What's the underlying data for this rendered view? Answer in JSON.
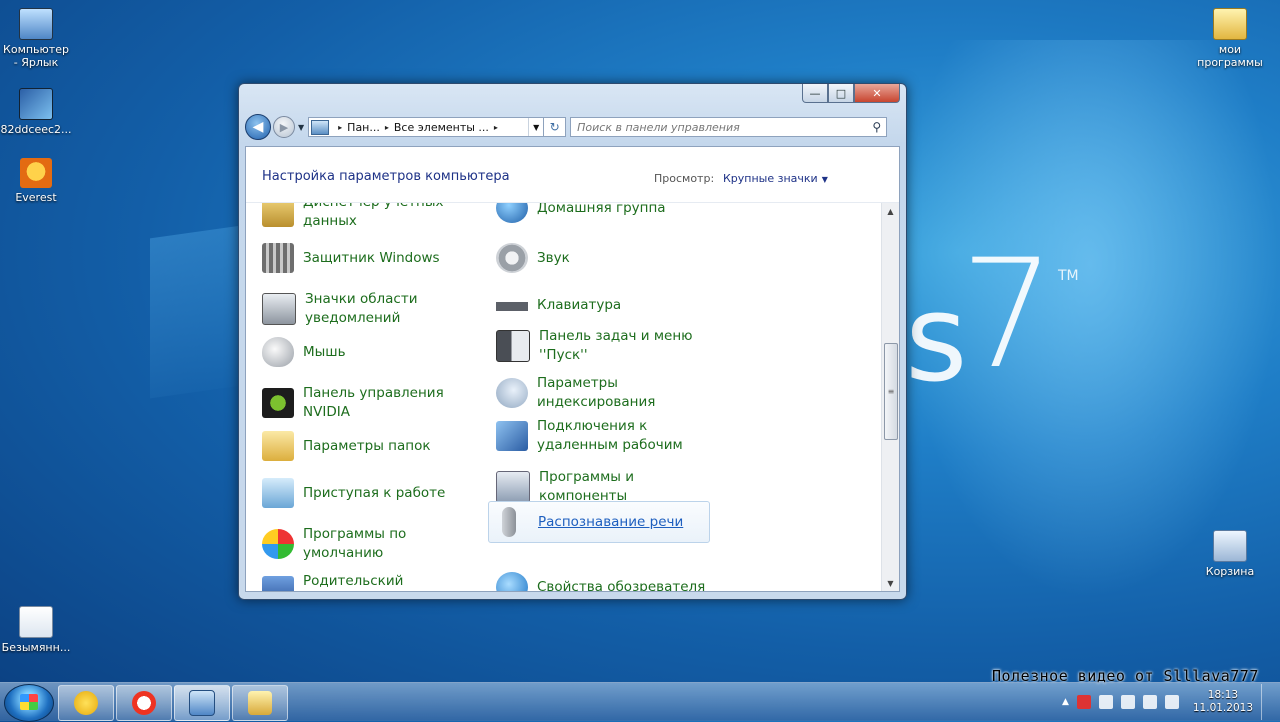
{
  "desktop": {
    "icons": [
      {
        "label": "Компьютер - Ярлык"
      },
      {
        "label": "82ddceec2..."
      },
      {
        "label": "Everest"
      },
      {
        "label": "Безымянн..."
      },
      {
        "label": "мои программы"
      },
      {
        "label": "Корзина"
      }
    ],
    "wallpaper_text": "s",
    "wallpaper_seven": "7",
    "wallpaper_tm": "TM",
    "watermark": "Полезное видео от Slllava777"
  },
  "window": {
    "caption": {
      "minimize": "—",
      "maximize": "□",
      "close": "✕"
    },
    "address": {
      "crumbs": [
        "Пан...",
        "Все элементы ..."
      ],
      "separator": "▸"
    },
    "search": {
      "placeholder": "Поиск в панели управления"
    },
    "title": "Настройка параметров компьютера",
    "view": {
      "label": "Просмотр:",
      "value": "Крупные значки"
    },
    "items_left": [
      {
        "label": "Диспетчер учетных данных",
        "icon": "credential-icon",
        "color": "#c7a14a"
      },
      {
        "label": "Защитник Windows",
        "icon": "defender-icon",
        "color": "#6e6e6e"
      },
      {
        "label": "Значки области уведомлений",
        "icon": "notification-area-icon",
        "color": "#9aa3ad"
      },
      {
        "label": "Мышь",
        "icon": "mouse-icon",
        "color": "#b9bfc7"
      },
      {
        "label": "Панель управления NVIDIA",
        "icon": "nvidia-icon",
        "color": "#4a8c1c"
      },
      {
        "label": "Параметры папок",
        "icon": "folder-options-icon",
        "color": "#e2be58"
      },
      {
        "label": "Приступая к работе",
        "icon": "getting-started-icon",
        "color": "#6aa6d6"
      },
      {
        "label": "Программы по умолчанию",
        "icon": "default-programs-icon",
        "color": "#3e9b3e"
      },
      {
        "label": "Родительский контроль",
        "icon": "parental-control-icon",
        "color": "#3b70b8"
      }
    ],
    "items_right": [
      {
        "label": "Домашняя группа",
        "icon": "homegroup-icon",
        "color": "#2f7fc1"
      },
      {
        "label": "Звук",
        "icon": "sound-icon",
        "color": "#a8acb2"
      },
      {
        "label": "Клавиатура",
        "icon": "keyboard-icon",
        "color": "#5c6068"
      },
      {
        "label": "Панель задач и меню ''Пуск''",
        "icon": "taskbar-icon",
        "color": "#4a4e55"
      },
      {
        "label": "Параметры индексирования",
        "icon": "indexing-icon",
        "color": "#8fa6c0"
      },
      {
        "label": "Подключения к удаленным рабочим",
        "icon": "remote-desktop-icon",
        "color": "#3d6fb0"
      },
      {
        "label": "Программы и компоненты",
        "icon": "programs-icon",
        "color": "#8d9db3"
      },
      {
        "label": "Распознавание речи",
        "icon": "microphone-icon",
        "color": "#b3b8be"
      },
      {
        "label": "Свойства обозревателя",
        "icon": "internet-options-icon",
        "color": "#2d8ed6"
      }
    ]
  },
  "taskbar": {
    "clock": {
      "time": "18:13",
      "date": "11.01.2013"
    }
  }
}
